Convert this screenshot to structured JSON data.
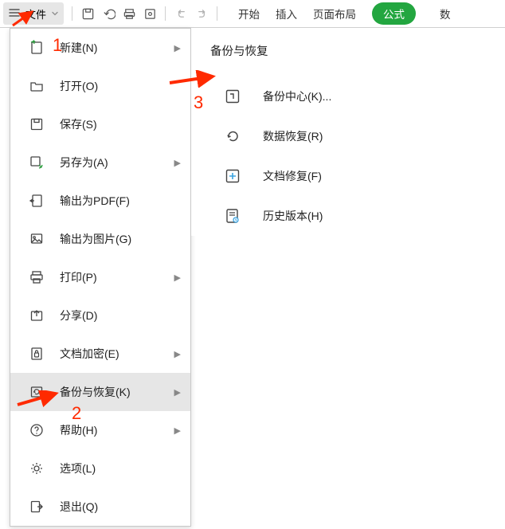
{
  "filebtn": {
    "label": "文件"
  },
  "tabs": {
    "start": "开始",
    "insert": "插入",
    "layout": "页面布局",
    "formula": "公式",
    "trailing": "数"
  },
  "menu": {
    "new": "新建(N)",
    "open": "打开(O)",
    "save": "保存(S)",
    "saveas": "另存为(A)",
    "exportpdf": "输出为PDF(F)",
    "exportimg": "输出为图片(G)",
    "print": "打印(P)",
    "share": "分享(D)",
    "encrypt": "文档加密(E)",
    "backup": "备份与恢复(K)",
    "help": "帮助(H)",
    "options": "选项(L)",
    "exit": "退出(Q)"
  },
  "submenu": {
    "title": "备份与恢复",
    "backupcenter": "备份中心(K)...",
    "datarecover": "数据恢复(R)",
    "docrepair": "文档修复(F)",
    "history": "历史版本(H)"
  },
  "anno": {
    "n1": "1",
    "n2": "2",
    "n3": "3"
  }
}
